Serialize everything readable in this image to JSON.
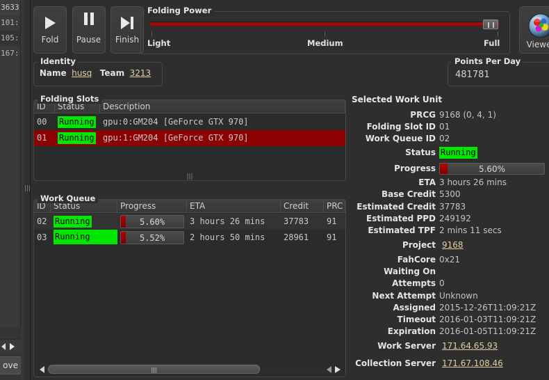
{
  "background_window": {
    "list_rows": [
      "3633",
      "101:",
      "105:",
      "167:"
    ],
    "button_label": "ove",
    "scroll_left_icon": "triangle-left-icon",
    "scroll_right_icon": "triangle-right-icon"
  },
  "transport": {
    "buttons": [
      {
        "label": "Fold",
        "icon": "play-icon"
      },
      {
        "label": "Pause",
        "icon": "pause-icon"
      },
      {
        "label": "Finish",
        "icon": "skip-to-end-icon"
      }
    ]
  },
  "folding_power": {
    "title": "Folding Power",
    "ticks": [
      "Light",
      "Medium",
      "Full"
    ],
    "value_percent": 100,
    "track_color": "#a01010"
  },
  "identity": {
    "title": "Identity",
    "name_label": "Name",
    "name_value": "husq",
    "team_label": "Team",
    "team_value": "3213"
  },
  "points_per_day": {
    "title": "Points Per Day",
    "value": "481781"
  },
  "viewer": {
    "label": "Viewer",
    "icon": "protein-globe-icon"
  },
  "folding_slots": {
    "title": "Folding Slots",
    "columns": [
      "ID",
      "Status",
      "Description"
    ],
    "rows": [
      {
        "id": "00",
        "status": "Running",
        "description": "gpu:0:GM204 [GeForce GTX 970]",
        "selected": false
      },
      {
        "id": "01",
        "status": "Running",
        "description": "gpu:1:GM204 [GeForce GTX 970]",
        "selected": true
      }
    ]
  },
  "work_queue": {
    "title": "Work Queue",
    "columns": [
      "ID",
      "Status",
      "Progress",
      "ETA",
      "Credit",
      "PRC"
    ],
    "rows": [
      {
        "id": "02",
        "status": "Running",
        "progress": "5.60%",
        "progress_value": 5.6,
        "eta": "3 hours 26 mins",
        "credit": "37783",
        "prcg": "91",
        "selected": false
      },
      {
        "id": "03",
        "status": "Running",
        "progress": "5.52%",
        "progress_value": 5.52,
        "eta": "2 hours 50 mins",
        "credit": "28961",
        "prcg": "91",
        "selected": false
      }
    ]
  },
  "selected_work_unit": {
    "title": "Selected Work Unit",
    "progress_label": "Progress",
    "progress_value_text": "5.60%",
    "progress_percent": 5.6,
    "status_label": "Status",
    "status_value": "Running",
    "fields": [
      {
        "key": "PRCG",
        "value": "9168 (0, 4, 1)"
      },
      {
        "key": "Folding Slot ID",
        "value": "01"
      },
      {
        "key": "Work Queue ID",
        "value": "02"
      },
      {
        "key": "ETA",
        "value": "3 hours 26 mins"
      },
      {
        "key": "Base Credit",
        "value": "5300"
      },
      {
        "key": "Estimated Credit",
        "value": "37783"
      },
      {
        "key": "Estimated PPD",
        "value": "249192"
      },
      {
        "key": "Estimated TPF",
        "value": "2 mins 11 secs"
      },
      {
        "key": "Project",
        "value": "9168",
        "link": true
      },
      {
        "key": "FahCore",
        "value": "0x21"
      },
      {
        "key": "Waiting On",
        "value": ""
      },
      {
        "key": "Attempts",
        "value": "0"
      },
      {
        "key": "Next Attempt",
        "value": "Unknown"
      },
      {
        "key": "Assigned",
        "value": "2015-12-26T11:09:21Z"
      },
      {
        "key": "Timeout",
        "value": "2016-01-03T11:09:21Z"
      },
      {
        "key": "Expiration",
        "value": "2016-01-05T11:09:21Z"
      },
      {
        "key": "Work Server",
        "value": "171.64.65.93",
        "link": true
      },
      {
        "key": "Collection Server",
        "value": "171.67.108.46",
        "link": true
      }
    ]
  },
  "colors": {
    "running_badge_bg": "#00e800",
    "selected_row_bg": "#8b0000",
    "link": "#e0cfa0",
    "progress_fill": "#b40000"
  }
}
